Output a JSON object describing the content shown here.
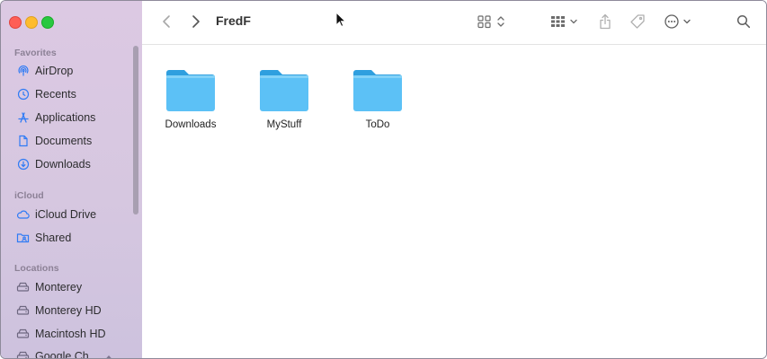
{
  "window": {
    "title": "FredF"
  },
  "sidebar": {
    "sections": [
      {
        "label": "Favorites"
      },
      {
        "label": "iCloud"
      },
      {
        "label": "Locations"
      }
    ],
    "favorites": [
      {
        "label": "AirDrop",
        "icon": "airdrop-icon"
      },
      {
        "label": "Recents",
        "icon": "clock-icon"
      },
      {
        "label": "Applications",
        "icon": "applications-icon"
      },
      {
        "label": "Documents",
        "icon": "document-icon"
      },
      {
        "label": "Downloads",
        "icon": "download-icon"
      }
    ],
    "icloud": [
      {
        "label": "iCloud Drive",
        "icon": "cloud-icon"
      },
      {
        "label": "Shared",
        "icon": "shared-folder-icon"
      }
    ],
    "locations": [
      {
        "label": "Monterey",
        "icon": "disk-icon"
      },
      {
        "label": "Monterey HD",
        "icon": "disk-icon"
      },
      {
        "label": "Macintosh HD",
        "icon": "disk-icon"
      },
      {
        "label": "Google Ch",
        "icon": "disk-icon"
      }
    ]
  },
  "folders": [
    {
      "label": "Downloads"
    },
    {
      "label": "MyStuff"
    },
    {
      "label": "ToDo"
    }
  ],
  "colors": {
    "accent": "#2f7bf5",
    "folder": "#5ac0f5",
    "sidebar": "#d8c8e1"
  }
}
